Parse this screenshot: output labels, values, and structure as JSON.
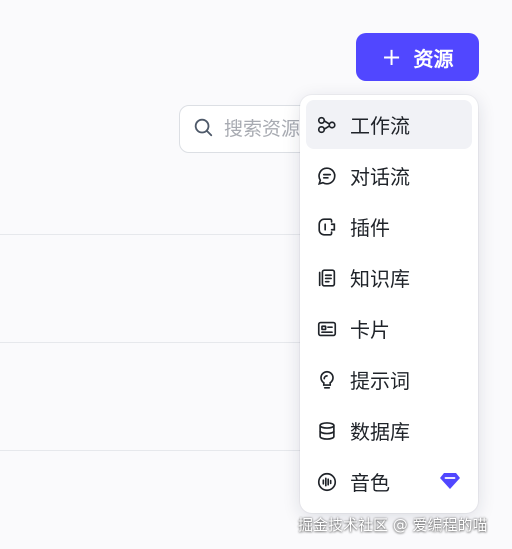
{
  "toolbar": {
    "add_resource_icon": "plus-icon",
    "add_resource_label": "资源",
    "accent_color": "#5147ff"
  },
  "search": {
    "placeholder": "搜索资源",
    "icon": "search-icon"
  },
  "resource_menu": {
    "items": [
      {
        "label": "工作流",
        "icon": "workflow-icon",
        "active": true
      },
      {
        "label": "对话流",
        "icon": "chat-flow-icon"
      },
      {
        "label": "插件",
        "icon": "plugin-icon"
      },
      {
        "label": "知识库",
        "icon": "knowledge-base-icon"
      },
      {
        "label": "卡片",
        "icon": "card-icon"
      },
      {
        "label": "提示词",
        "icon": "prompt-icon"
      },
      {
        "label": "数据库",
        "icon": "database-icon"
      },
      {
        "label": "音色",
        "icon": "voice-icon",
        "badge": "premium-diamond-icon",
        "badge_color": "#5147ff"
      }
    ]
  },
  "watermark": "掘金技术社区 @ 爱编程的喵"
}
